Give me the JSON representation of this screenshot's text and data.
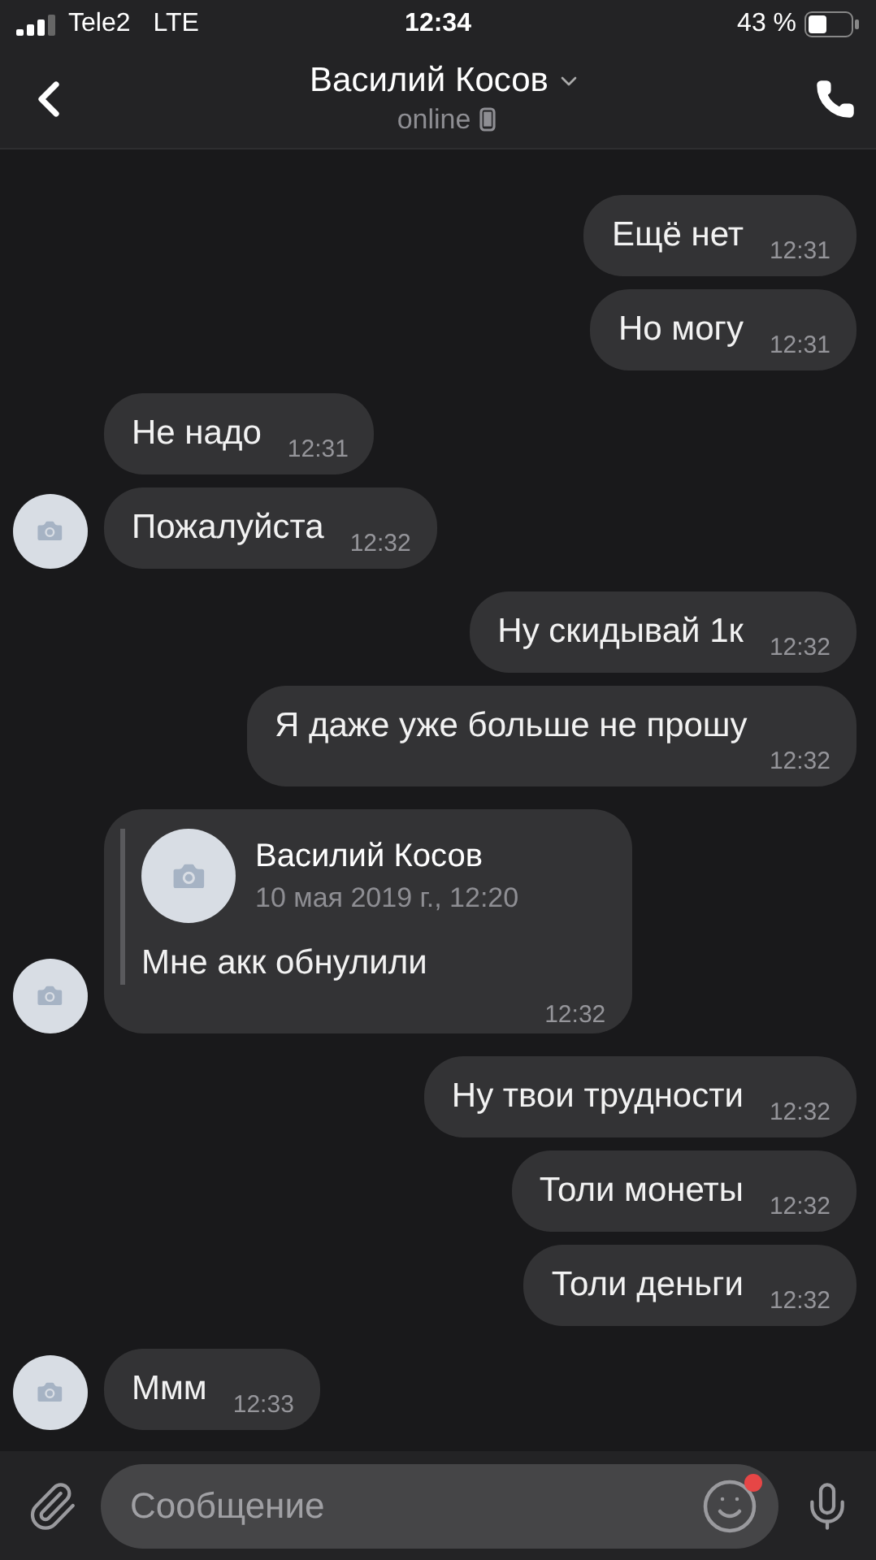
{
  "status_bar": {
    "carrier": "Tele2",
    "network": "LTE",
    "time": "12:34",
    "battery": "43 %"
  },
  "header": {
    "name": "Василий Косов",
    "status": "online"
  },
  "messages": [
    {
      "kind": "out",
      "text": "Ещё нет",
      "time": "12:31"
    },
    {
      "kind": "out",
      "text": "Но могу",
      "time": "12:31"
    },
    {
      "kind": "in",
      "text": "Не надо",
      "time": "12:31",
      "avatar": false
    },
    {
      "kind": "in",
      "text": "Пожалуйста",
      "time": "12:32",
      "avatar": true
    },
    {
      "kind": "out",
      "text": "Ну скидывай 1к",
      "time": "12:32"
    },
    {
      "kind": "out",
      "text": "Я даже уже больше не прошу",
      "time": "12:32"
    },
    {
      "kind": "in",
      "text": "Мне акк обнулили",
      "time": "12:32",
      "avatar": true,
      "forwarded": {
        "author": "Василий Косов",
        "date": "10 мая 2019 г., 12:20"
      }
    },
    {
      "kind": "out",
      "text": "Ну твои трудности",
      "time": "12:32"
    },
    {
      "kind": "out",
      "text": "Толи монеты",
      "time": "12:32"
    },
    {
      "kind": "out",
      "text": "Толи деньги",
      "time": "12:32"
    },
    {
      "kind": "in",
      "text": "Ммм",
      "time": "12:33",
      "avatar": true
    }
  ],
  "composer": {
    "placeholder": "Сообщение",
    "emoji_badge": true
  }
}
